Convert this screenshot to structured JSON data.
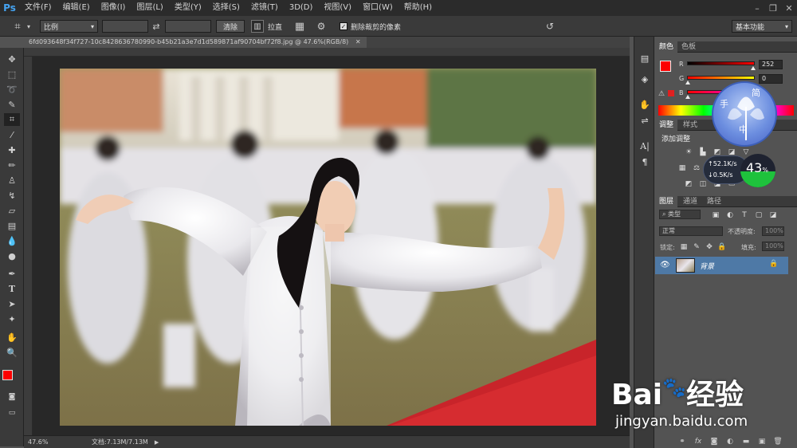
{
  "app": {
    "logo": "Ps"
  },
  "menu": [
    "文件(F)",
    "编辑(E)",
    "图像(I)",
    "图层(L)",
    "类型(Y)",
    "选择(S)",
    "滤镜(T)",
    "3D(D)",
    "视图(V)",
    "窗口(W)",
    "帮助(H)"
  ],
  "options": {
    "ratio_label": "比例",
    "clear_label": "清除",
    "straighten_label": "拉直",
    "delete_cropped_label": "删除裁剪的像素",
    "workspace_label": "基本功能"
  },
  "document": {
    "tab_title": "6fd093648f34f727-10c8428636780990-b45b21a3e7d1d589871af90704bf72f8.jpg @ 47.6%(RGB/8)",
    "zoom": "47.6%",
    "doc_size": "文档:7.13M/7.13M"
  },
  "color_panel": {
    "tabs": [
      "颜色",
      "色板"
    ],
    "channels": [
      {
        "label": "R",
        "value": "252",
        "color": "#fc0000"
      },
      {
        "label": "G",
        "value": "0",
        "color": "#00ff00"
      },
      {
        "label": "B",
        "value": "",
        "color": "#0000ff"
      }
    ],
    "fg_color": "#fc0000"
  },
  "adjust_panel": {
    "tabs": [
      "调整",
      "样式"
    ],
    "title": "添加调整"
  },
  "speed_widget": {
    "up": "52.1K/s",
    "down": "0.5K/s",
    "percent": "43",
    "percent_sign": "%"
  },
  "overlay_widget": {
    "chars": [
      "手",
      "简",
      "中"
    ]
  },
  "layers_panel": {
    "tabs": [
      "图层",
      "通道",
      "路径"
    ],
    "filter": "类型",
    "blend_mode": "正常",
    "opacity_label": "不透明度:",
    "opacity_value": "100%",
    "lock_label": "锁定:",
    "fill_label": "填充:",
    "fill_value": "100%",
    "layer_name": "背景"
  },
  "watermark": {
    "brand": "Bai",
    "brand2": "经验",
    "url": "jingyan.baidu.com"
  }
}
